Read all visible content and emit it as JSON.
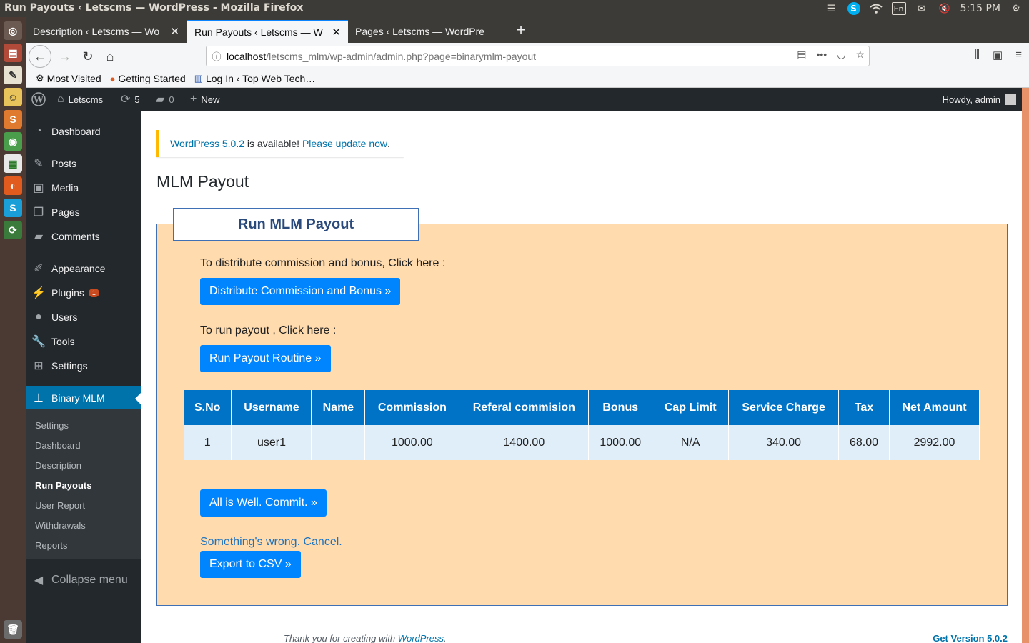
{
  "os_panel": {
    "window_title": "Run Payouts ‹ Letscms — WordPress - Mozilla Firefox",
    "keyboard_layout": "En",
    "clock": "5:15 PM",
    "icons": [
      "menu-icon",
      "skype-icon",
      "wifi-icon",
      "keyboard-icon",
      "mail-icon",
      "volume-muted-icon",
      "settings-gear-icon"
    ]
  },
  "launcher": {
    "apps": [
      "ubuntu-dash-icon",
      "files-icon",
      "text-editor-icon",
      "mascot-icon",
      "sublime-text-icon",
      "chrome-icon",
      "spreadsheet-icon",
      "firefox-icon",
      "skype-icon",
      "updater-icon",
      "trash-icon"
    ]
  },
  "browser": {
    "tabs": [
      {
        "label": "Description ‹ Letscms — Wo",
        "active": false
      },
      {
        "label": "Run Payouts ‹ Letscms — W",
        "active": true
      },
      {
        "label": "Pages ‹ Letscms — WordPre",
        "active": false
      }
    ],
    "url_host": "localhost",
    "url_path": "/letscms_mlm/wp-admin/admin.php?page=binarymlm-payout",
    "bookmarks": [
      {
        "label": "Most Visited",
        "icon": "gear-icon"
      },
      {
        "label": "Getting Started",
        "icon": "firefox-icon"
      },
      {
        "label": "Log In ‹ Top Web Tech…",
        "icon": "site-icon"
      }
    ]
  },
  "admin_bar": {
    "site_name": "Letscms",
    "updates_count": "5",
    "comments_count": "0",
    "new_label": "New",
    "greeting": "Howdy, admin"
  },
  "sidebar": {
    "items": [
      {
        "label": "Dashboard",
        "icon": "dashboard-icon"
      },
      {
        "label": "Posts",
        "icon": "pin-icon"
      },
      {
        "label": "Media",
        "icon": "media-icon"
      },
      {
        "label": "Pages",
        "icon": "pages-icon"
      },
      {
        "label": "Comments",
        "icon": "comment-icon"
      },
      {
        "label": "Appearance",
        "icon": "brush-icon"
      },
      {
        "label": "Plugins",
        "icon": "plugin-icon",
        "badge": "1"
      },
      {
        "label": "Users",
        "icon": "user-icon"
      },
      {
        "label": "Tools",
        "icon": "wrench-icon"
      },
      {
        "label": "Settings",
        "icon": "settings-icon"
      },
      {
        "label": "Binary MLM",
        "icon": "network-icon"
      }
    ],
    "submenu": [
      "Settings",
      "Dashboard",
      "Description",
      "Run Payouts",
      "User Report",
      "Withdrawals",
      "Reports"
    ],
    "collapse_label": "Collapse menu"
  },
  "notice": {
    "version_link": "WordPress 5.0.2",
    "text": " is available! ",
    "update_link": "Please update now",
    "period": "."
  },
  "page": {
    "title": "MLM Payout",
    "box_title": "Run MLM Payout",
    "distribute_text": "To distribute commission and bonus, Click here :",
    "distribute_button": "Distribute Commission and Bonus »",
    "payout_text": "To run payout , Click here :",
    "payout_button": "Run Payout Routine »",
    "table": {
      "headers": [
        "S.No",
        "Username",
        "Name",
        "Commission",
        "Referal commision",
        "Bonus",
        "Cap Limit",
        "Service Charge",
        "Tax",
        "Net Amount"
      ],
      "rows": [
        [
          "1",
          "user1",
          "",
          "1000.00",
          "1400.00",
          "1000.00",
          "N/A",
          "340.00",
          "68.00",
          "2992.00"
        ]
      ]
    },
    "commit_button": "All is Well. Commit. »",
    "cancel_link": "Something's wrong. Cancel.",
    "export_button": "Export to CSV »"
  },
  "footer": {
    "thanks_prefix": "Thank you for creating with ",
    "thanks_link": "WordPress",
    "thanks_suffix": ".",
    "version": "Get Version 5.0.2"
  },
  "colors": {
    "wp_sidebar": "#23282d",
    "wp_accent": "#0073aa",
    "payout_box_bg": "#ffdbae",
    "button_blue": "#0085ff",
    "table_header": "#0073c6",
    "notice_border": "#ffb900"
  }
}
